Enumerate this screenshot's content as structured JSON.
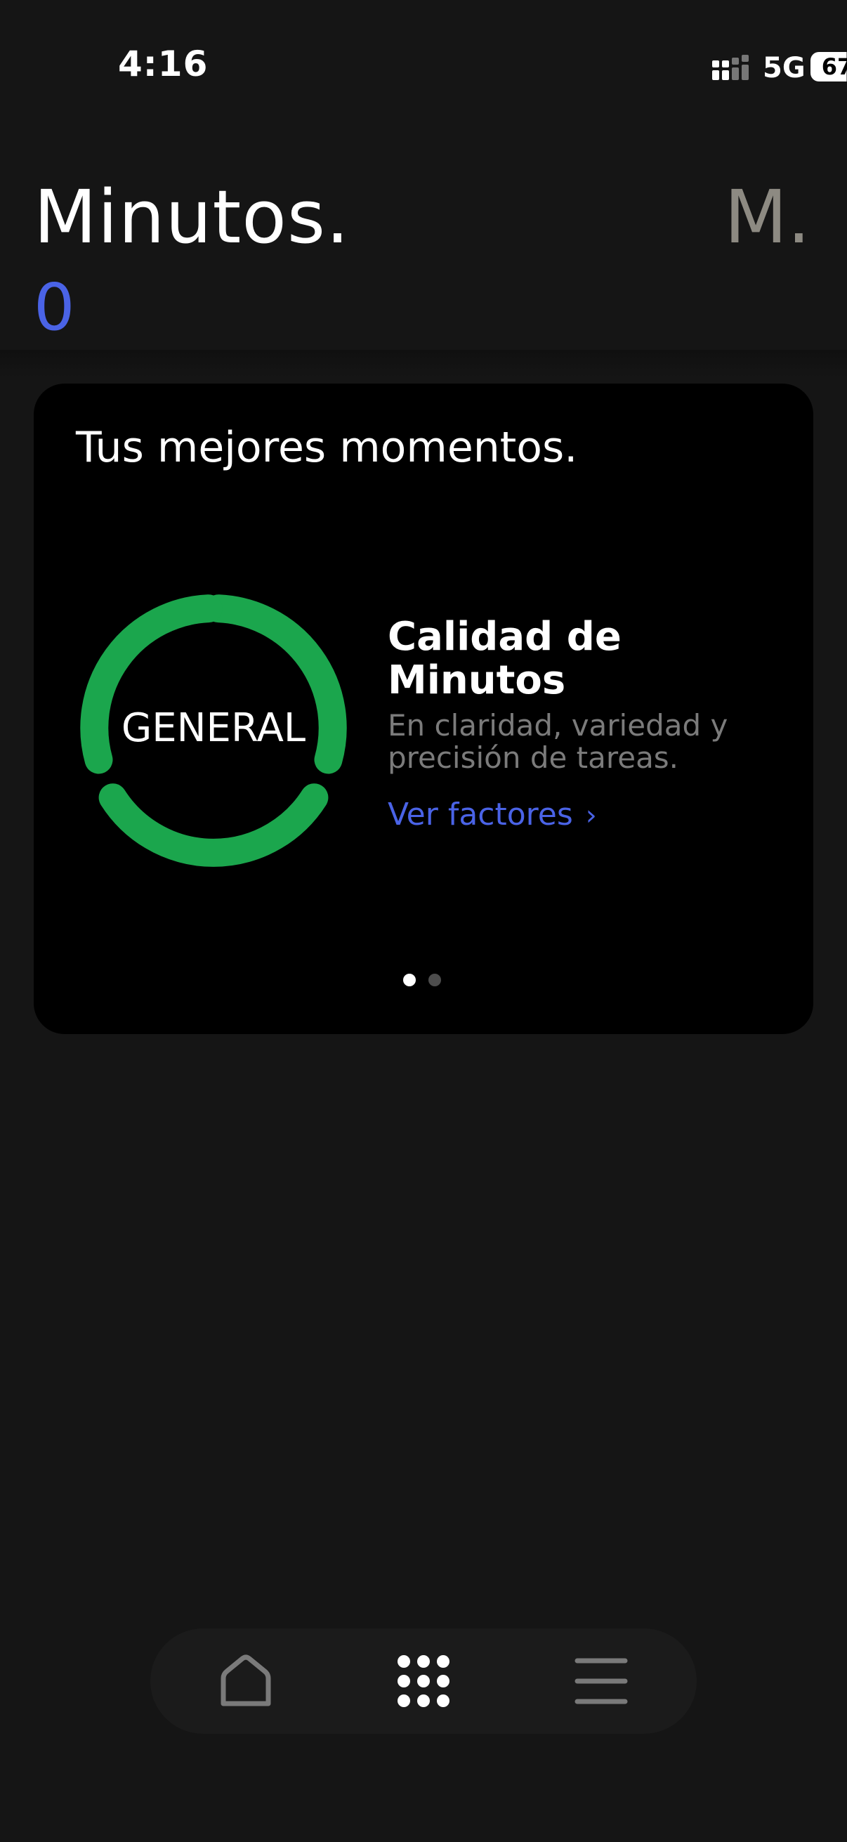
{
  "status_bar": {
    "time": "4:16",
    "network": "5G",
    "battery": "67"
  },
  "header": {
    "title": "Minutos.",
    "minutes_value": "0",
    "avatar_initial": "M."
  },
  "card": {
    "title": "Tus mejores momentos.",
    "ring_label": "GENERAL",
    "ring_color": "#1ba64d",
    "metric_title": "Calidad de Minutos",
    "metric_description": "En claridad, variedad y precisión de tareas.",
    "link_label": "Ver factores",
    "pager": {
      "total": 2,
      "active": 1
    }
  },
  "bottom_nav": {
    "items": [
      {
        "icon": "home-icon"
      },
      {
        "icon": "grid-icon"
      },
      {
        "icon": "menu-icon"
      }
    ]
  },
  "colors": {
    "background": "#151515",
    "card": "#000000",
    "accent_blue": "#4a63e6",
    "ring_green": "#1ba64d"
  }
}
